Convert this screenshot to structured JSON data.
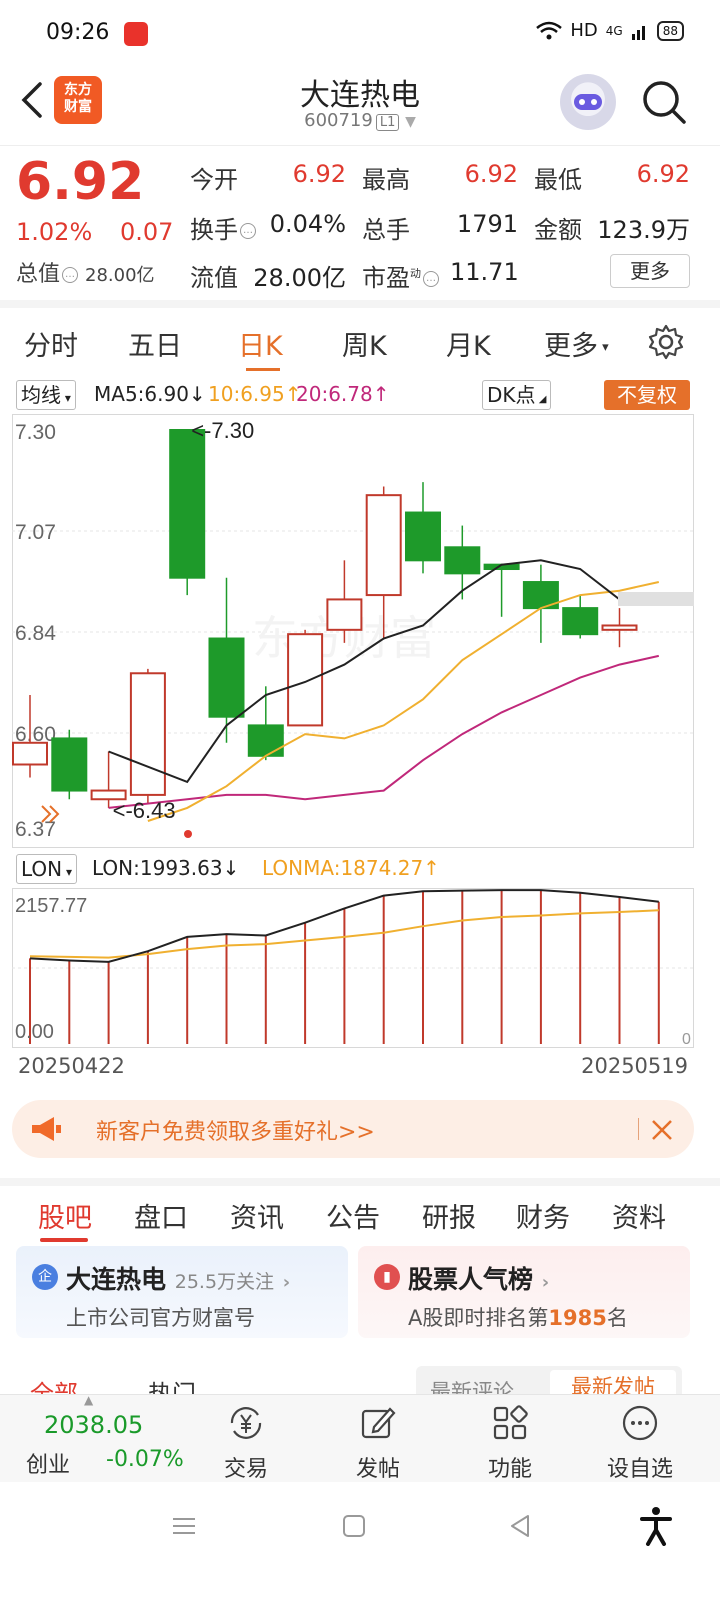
{
  "status_bar": {
    "time": "09:26",
    "network": "HD",
    "signal": "4G",
    "battery": "88"
  },
  "header": {
    "logo_text": "东方\n财富",
    "stock_name": "大连热电",
    "stock_code": "600719",
    "level_badge": "L1"
  },
  "quote": {
    "last_price": "6.92",
    "change_pct": "1.02%",
    "change_amt": "0.07",
    "total_mv_label": "总值",
    "total_mv_value": "28.00亿",
    "open_label": "今开",
    "open_value": "6.92",
    "high_label": "最高",
    "high_value": "6.92",
    "low_label": "最低",
    "low_value": "6.92",
    "turnover_label": "换手",
    "turnover_value": "0.04%",
    "volume_label": "总手",
    "volume_value": "1791",
    "amount_label": "金额",
    "amount_value": "123.9万",
    "float_mv_label": "流值",
    "float_mv_value": "28.00亿",
    "pe_label": "市盈",
    "pe_sup": "动",
    "pe_value": "11.71",
    "more_label": "更多"
  },
  "period_tabs": [
    "分时",
    "五日",
    "日K",
    "周K",
    "月K",
    "更多"
  ],
  "active_period": "日K",
  "ma_row": {
    "selector": "均线",
    "ma5": "MA5:6.90↓",
    "ma10": "10:6.95↑",
    "ma20": "20:6.78↑",
    "dk": "DK点",
    "fq": "不复权"
  },
  "lon_row": {
    "selector": "LON",
    "lon": "LON:1993.63↓",
    "lonma": "LONMA:1874.27↑"
  },
  "colors": {
    "up": "#c0392b",
    "down": "#1e9a2a",
    "ma5": "#222222",
    "ma10": "#f0b030",
    "ma20": "#c0287a",
    "accent": "#e5702a"
  },
  "chart_data": [
    {
      "type": "candlestick",
      "yticks": [
        "7.30",
        "7.07",
        "6.84",
        "6.60",
        "6.37"
      ],
      "ylim": [
        6.37,
        7.3
      ],
      "annotations": {
        "high_label": "<-7.30",
        "low_label": "<-6.43"
      },
      "candles": [
        {
          "o": 6.53,
          "c": 6.58,
          "h": 6.69,
          "l": 6.5
        },
        {
          "o": 6.59,
          "c": 6.47,
          "h": 6.61,
          "l": 6.45
        },
        {
          "o": 6.45,
          "c": 6.47,
          "h": 6.56,
          "l": 6.43
        },
        {
          "o": 6.46,
          "c": 6.74,
          "h": 6.75,
          "l": 6.44
        },
        {
          "o": 7.3,
          "c": 6.96,
          "h": 7.3,
          "l": 6.92
        },
        {
          "o": 6.82,
          "c": 6.64,
          "h": 6.96,
          "l": 6.58
        },
        {
          "o": 6.62,
          "c": 6.55,
          "h": 6.71,
          "l": 6.54
        },
        {
          "o": 6.62,
          "c": 6.83,
          "h": 6.84,
          "l": 6.62
        },
        {
          "o": 6.84,
          "c": 6.91,
          "h": 7.0,
          "l": 6.81
        },
        {
          "o": 6.92,
          "c": 7.15,
          "h": 7.17,
          "l": 6.82
        },
        {
          "o": 7.11,
          "c": 7.0,
          "h": 7.18,
          "l": 6.97
        },
        {
          "o": 7.03,
          "c": 6.97,
          "h": 7.08,
          "l": 6.91
        },
        {
          "o": 6.99,
          "c": 6.98,
          "h": 6.99,
          "l": 6.87
        },
        {
          "o": 6.95,
          "c": 6.89,
          "h": 6.99,
          "l": 6.81
        },
        {
          "o": 6.89,
          "c": 6.83,
          "h": 6.92,
          "l": 6.82
        },
        {
          "o": 6.84,
          "c": 6.85,
          "h": 6.89,
          "l": 6.8
        },
        {
          "o": 6.92,
          "c": 6.92,
          "h": 6.92,
          "l": 6.92
        }
      ],
      "ma5": [
        6.56,
        null,
        6.49,
        6.62,
        6.69,
        6.72,
        6.76,
        6.82,
        6.85,
        6.93,
        6.99,
        7.0,
        6.98,
        6.91,
        6.9
      ],
      "ma10": [
        6.4,
        6.43,
        6.48,
        6.55,
        6.6,
        6.59,
        6.62,
        6.68,
        6.77,
        6.83,
        6.89,
        6.92,
        6.93,
        6.95
      ],
      "ma20": [
        6.43,
        null,
        6.45,
        6.46,
        6.46,
        6.45,
        6.46,
        6.47,
        6.54,
        6.6,
        6.65,
        6.69,
        6.73,
        6.76,
        6.78
      ]
    },
    {
      "type": "bar+line",
      "yticks": [
        "2157.77",
        "0.00"
      ],
      "ylim": [
        0,
        2157.77
      ],
      "right_label": "0",
      "lon": [
        1200,
        1170,
        1150,
        1300,
        1500,
        1540,
        1520,
        1700,
        1900,
        2080,
        2140,
        2150,
        2157,
        2157,
        2120,
        2060,
        1994
      ],
      "lonma": [
        1230,
        1220,
        1210,
        1260,
        1330,
        1380,
        1400,
        1450,
        1500,
        1560,
        1650,
        1730,
        1780,
        1800,
        1830,
        1850,
        1874
      ],
      "x_start": "20250422",
      "x_end": "20250519"
    }
  ],
  "promo": {
    "text": "新客户免费领取多重好礼>>"
  },
  "section_tabs": [
    "股吧",
    "盘口",
    "资讯",
    "公告",
    "研报",
    "财务",
    "资料"
  ],
  "cards": {
    "company": {
      "badge": "企",
      "title": "大连热电",
      "followers": "25.5万关注",
      "subtitle": "上市公司官方财富号"
    },
    "ranking": {
      "title": "股票人气榜",
      "subtitle_prefix": "A股即时排名第",
      "rank": "1985",
      "subtitle_suffix": "名"
    }
  },
  "filters": {
    "all": "全部",
    "hot": "热门",
    "latest_comment": "最新评论",
    "latest_post": "最新发帖"
  },
  "bottom_bar": {
    "index_value": "2038.05",
    "index_name": "创业",
    "index_change": "-0.07%",
    "trade": "交易",
    "post": "发帖",
    "functions": "功能",
    "watchlist": "设自选"
  }
}
